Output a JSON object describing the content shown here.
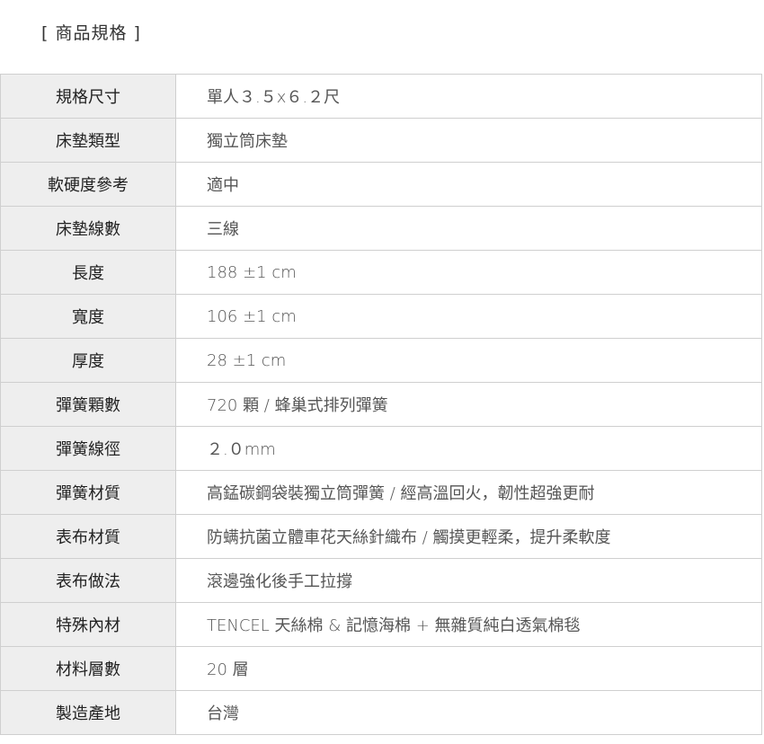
{
  "header": {
    "title": "[ 商品規格 ]"
  },
  "specs": [
    {
      "label": "規格尺寸",
      "value": "單人３.５x６.２尺"
    },
    {
      "label": "床墊類型",
      "value": "獨立筒床墊"
    },
    {
      "label": "軟硬度參考",
      "value": "適中"
    },
    {
      "label": "床墊線數",
      "value": "三線"
    },
    {
      "label": "長度",
      "value": "188 ±1 cm"
    },
    {
      "label": "寬度",
      "value": "106 ±1 cm"
    },
    {
      "label": "厚度",
      "value": "28 ±1 cm"
    },
    {
      "label": "彈簧顆數",
      "value": "720 顆 / 蜂巢式排列彈簧"
    },
    {
      "label": "彈簧線徑",
      "value": "２.０mm"
    },
    {
      "label": "彈簧材質",
      "value": "高錳碳鋼袋裝獨立筒彈簧 / 經高溫回火，韌性超強更耐"
    },
    {
      "label": "表布材質",
      "value": "防螨抗菌立體車花天絲針織布 / 觸摸更輕柔，提升柔軟度"
    },
    {
      "label": "表布做法",
      "value": "滾邊強化後手工拉撐"
    },
    {
      "label": "特殊內材",
      "value": "TENCEL 天絲棉 & 記憶海棉 + 無雜質純白透氣棉毯"
    },
    {
      "label": "材料層數",
      "value": "20 層"
    },
    {
      "label": "製造產地",
      "value": "台灣"
    }
  ]
}
